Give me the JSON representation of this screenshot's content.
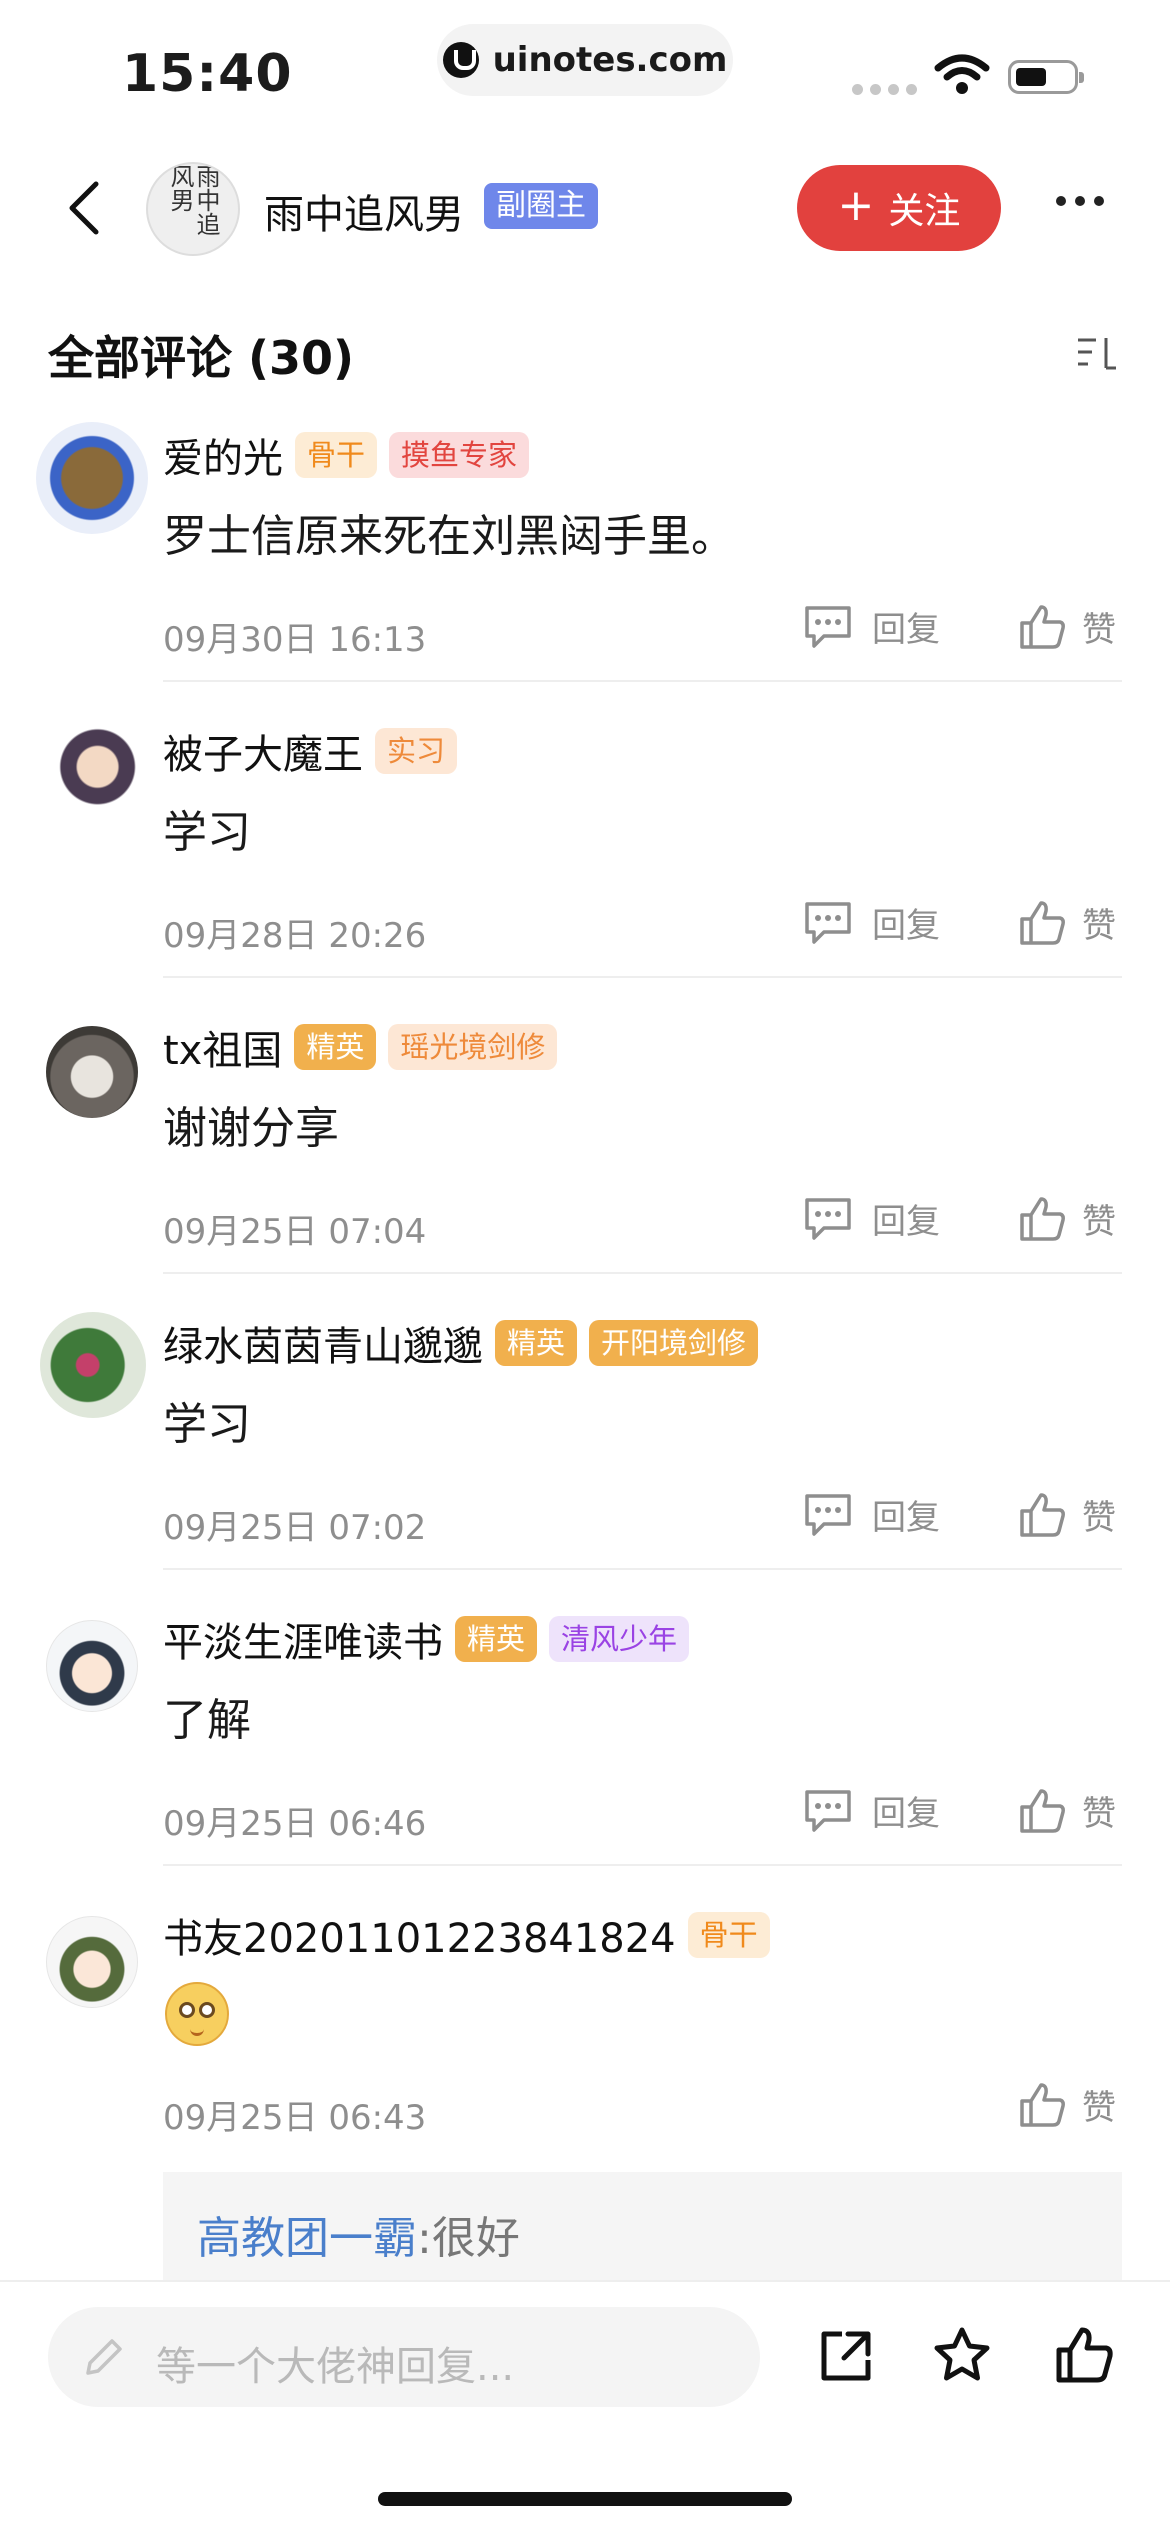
{
  "status": {
    "time": "15:40",
    "url": "uinotes.com"
  },
  "header": {
    "name": "雨中追风男",
    "role": "副圈主",
    "follow_label": "关注",
    "follow_plus": "+",
    "avatar_text": "雨中追风男"
  },
  "section": {
    "title": "全部评论 (30)"
  },
  "actions": {
    "reply": "回复",
    "like": "赞"
  },
  "comments": [
    {
      "name": "爱的光",
      "badges": [
        "骨干",
        "摸鱼专家"
      ],
      "text": "罗士信原来死在刘黑闼手里。",
      "time": "09月30日 16:13"
    },
    {
      "name": "被子大魔王",
      "badges": [
        "实习"
      ],
      "text": "学习",
      "time": "09月28日 20:26"
    },
    {
      "name": "tx祖国",
      "badges": [
        "精英",
        "瑶光境剑修"
      ],
      "text": "谢谢分享",
      "time": "09月25日 07:04"
    },
    {
      "name": "绿水茵茵青山邈邈",
      "badges": [
        "精英",
        "开阳境剑修"
      ],
      "text": "学习",
      "time": "09月25日 07:02"
    },
    {
      "name": "平淡生涯唯读书",
      "badges": [
        "精英",
        "清风少年"
      ],
      "text": "了解",
      "time": "09月25日 06:46"
    },
    {
      "name": "书友20201101223841824",
      "badges": [
        "骨干"
      ],
      "emoji": "sly-face-emoji",
      "time": "09月25日 06:43"
    }
  ],
  "sub_reply": {
    "author": "高教团一霸",
    "text": ":很好"
  },
  "bottom": {
    "placeholder": "等一个大佬神回复..."
  },
  "colors": {
    "accent_red": "#e2413e",
    "role_blue": "#6f87ea",
    "link_blue": "#4a7fcb"
  }
}
